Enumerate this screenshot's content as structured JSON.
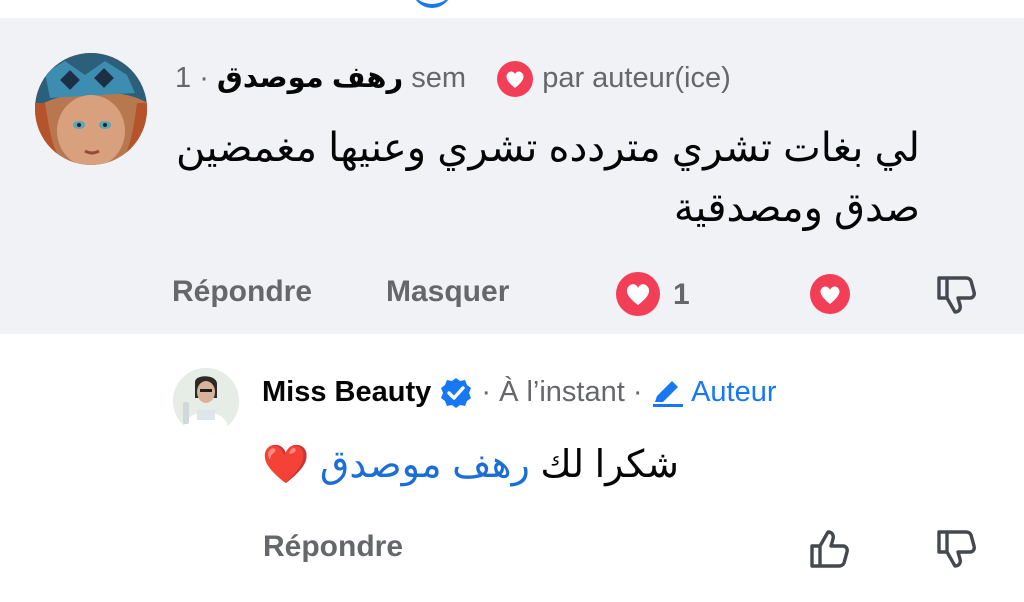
{
  "comment": {
    "author": "رهف موصدق",
    "time": "· 1 sem",
    "liked_by_author": "par auteur(ice)",
    "text": "لي بغات تشري متردده تشري وعنيها مغمضين صدق ومصدقية",
    "reply_label": "Répondre",
    "hide_label": "Masquer",
    "reaction_count": "1"
  },
  "reply": {
    "author": "Miss Beauty",
    "time": "· À l’instant ·",
    "author_tag": "Auteur",
    "mention": "رهف موصدق",
    "text": "شكرا لك",
    "emoji": "❤️",
    "reply_label": "Répondre"
  },
  "colors": {
    "background_highlight": "#f0f2f5",
    "accent": "#1877f2",
    "reaction": "#f33e58",
    "muted_text": "#65676b"
  },
  "icons": [
    "heart-reaction-icon",
    "heart-like-icon",
    "thumbs-down-icon",
    "verified-badge-icon",
    "pencil-icon",
    "thumbs-up-icon"
  ]
}
